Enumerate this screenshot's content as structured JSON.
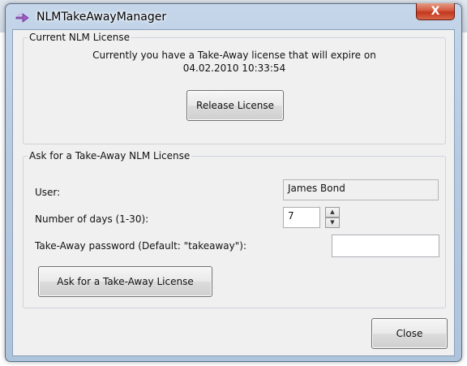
{
  "window": {
    "title": "NLMTakeAwayManager",
    "close_symbol": "X"
  },
  "current_license": {
    "legend": "Current NLM License",
    "message_line1": "Currently you have a Take-Away license that will expire on",
    "message_line2": "04.02.2010 10:33:54",
    "release_button": "Release License"
  },
  "ask_license": {
    "legend": "Ask for a Take-Away NLM License",
    "user_label": "User:",
    "user_value": "James Bond",
    "days_label": "Number of days (1-30):",
    "days_value": "7",
    "password_label": "Take-Away password (Default: \"takeaway\"):",
    "password_value": "",
    "ask_button": "Ask for a Take-Away License"
  },
  "footer": {
    "close_button": "Close"
  },
  "icons": {
    "app": "arrows-app-icon",
    "spin_up": "▲",
    "spin_down": "▼"
  }
}
